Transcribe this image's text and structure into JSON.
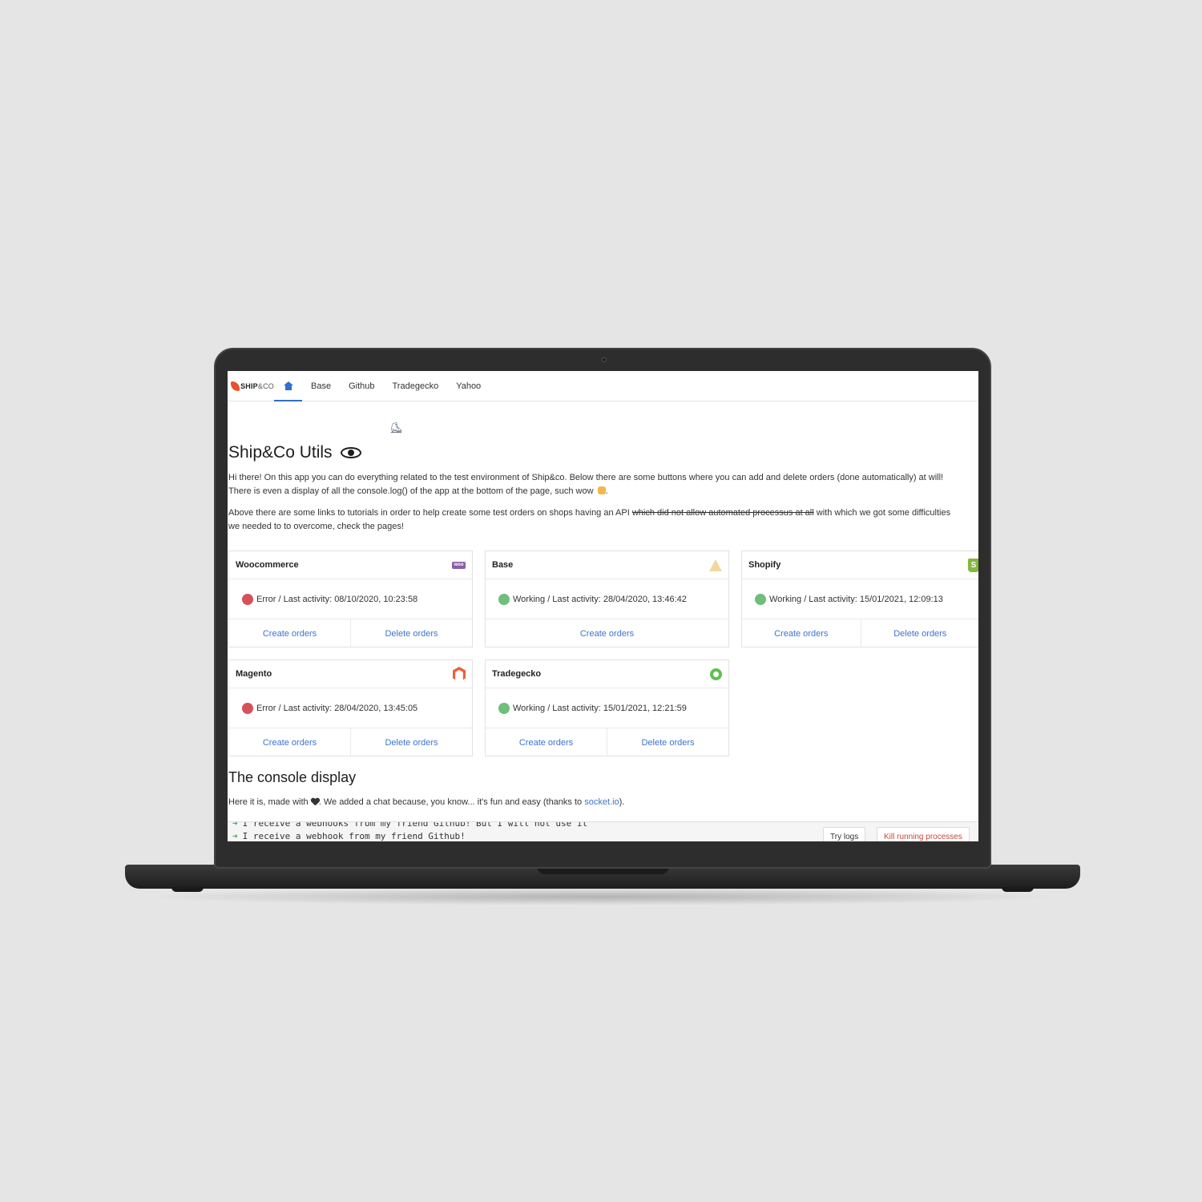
{
  "brand": {
    "logo_text": "SHIP",
    "logo_text_suffix": "&CO"
  },
  "nav": {
    "items": [
      {
        "label": "Base"
      },
      {
        "label": "Github"
      },
      {
        "label": "Tradegecko"
      },
      {
        "label": "Yahoo"
      }
    ]
  },
  "page": {
    "title": "Ship&Co Utils",
    "intro_line1": "Hi there! On this app you can do everything related to the test environment of Ship&co. Below there are some buttons where you can add and delete orders (done automatically) at will!",
    "intro_line2": "There is even a display of all the console.log() of the app at the bottom of the page, such wow",
    "intro2_part1": "Above there are some links to tutorials in order to help create some test orders on shops having an API",
    "intro2_strike": "which did not allow automated processus at all",
    "intro2_part2": "with which we got some difficulties",
    "intro2_line2": "we needed to to overcome, check the pages!"
  },
  "shops": [
    {
      "name": "Woocommerce",
      "icon": "woo-icon",
      "icon_text": "woo",
      "status": "Error",
      "status_text": "Error / Last activity: 08/10/2020, 10:23:58",
      "create": "Create orders",
      "delete": "Delete orders"
    },
    {
      "name": "Base",
      "icon": "base-icon",
      "status": "Working",
      "status_text": "Working / Last activity: 28/04/2020, 13:46:42",
      "create": "Create orders"
    },
    {
      "name": "Shopify",
      "icon": "shopify-icon",
      "icon_text": "S",
      "status": "Working",
      "status_text": "Working / Last activity: 15/01/2021, 12:09:13",
      "create": "Create orders",
      "delete": "Delete orders"
    },
    {
      "name": "Magento",
      "icon": "magento-icon",
      "status": "Error",
      "status_text": "Error / Last activity: 28/04/2020, 13:45:05",
      "create": "Create orders",
      "delete": "Delete orders"
    },
    {
      "name": "Tradegecko",
      "icon": "tradegecko-icon",
      "status": "Working",
      "status_text": "Working / Last activity: 15/01/2021, 12:21:59",
      "create": "Create orders",
      "delete": "Delete orders"
    }
  ],
  "console_section": {
    "title": "The console display",
    "text_before": "Here it is, made with",
    "text_after": ". We added a chat because, you know... it's fun and easy (thanks to",
    "link": "socket.io",
    "text_end": ")."
  },
  "console": {
    "lines": [
      "I receive a webhooks from my friend Github! But I will not use it",
      "I receive a webhook from my friend Github!"
    ],
    "try_logs": "Try logs",
    "kill": "Kill running processes"
  },
  "colors": {
    "accent": "#3b74d1",
    "error": "#d65159",
    "working": "#6fbe7a",
    "danger": "#c9473b"
  }
}
